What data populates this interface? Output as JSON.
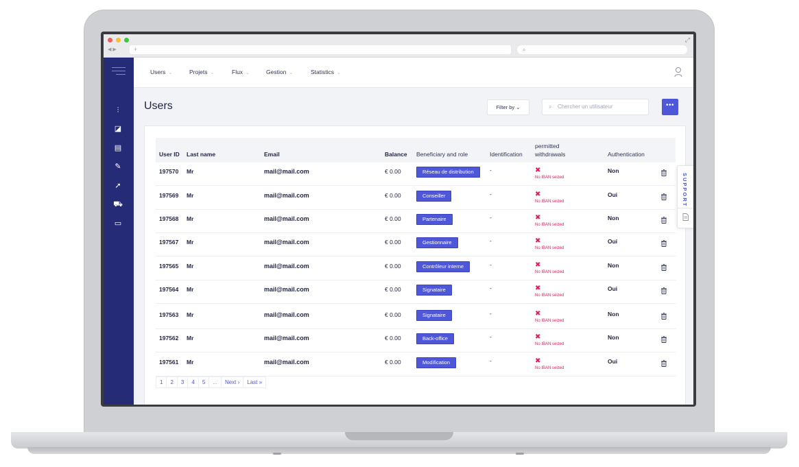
{
  "browser": {
    "url_placeholder": "+",
    "search_placeholder": "⌕",
    "nav_buttons": "◀ ▶",
    "expand_icon": "⤢"
  },
  "topnav": {
    "items": [
      {
        "label": "Users"
      },
      {
        "label": "Projets"
      },
      {
        "label": "Flux"
      },
      {
        "label": "Gestion"
      },
      {
        "label": "Statistics"
      }
    ],
    "chevron": "⌄"
  },
  "page": {
    "title": "Users",
    "filter_label": "Filter by ⌄",
    "search_placeholder": "Chercher un utilisateur",
    "more_label": "•••"
  },
  "table": {
    "headers": {
      "user_id": "User ID",
      "last_name": "Last name",
      "email": "Email",
      "balance": "Balance",
      "role": "Beneficiary and role",
      "identification": "Identification",
      "withdrawals_1": "permitted",
      "withdrawals_2": "withdrawals",
      "authentication": "Authentication"
    },
    "rows": [
      {
        "id": "197570",
        "name": "Mr",
        "email": "mail@mail.com",
        "balance": "€ 0.00",
        "role": "Réseau de distribution",
        "ident": "-",
        "withdraw_mark": "✖",
        "withdraw": "No IBAN seized",
        "auth": "Non"
      },
      {
        "id": "197569",
        "name": "Mr",
        "email": "mail@mail.com",
        "balance": "€ 0.00",
        "role": "Conseiller",
        "ident": "-",
        "withdraw_mark": "✖",
        "withdraw": "No IBAN seized",
        "auth": "Oui"
      },
      {
        "id": "197568",
        "name": "Mr",
        "email": "mail@mail.com",
        "balance": "€ 0.00",
        "role": "Partenaire",
        "ident": "-",
        "withdraw_mark": "✖",
        "withdraw": "No IBAN seized",
        "auth": "Non"
      },
      {
        "id": "197567",
        "name": "Mr",
        "email": "mail@mail.com",
        "balance": "€ 0.00",
        "role": "Gestionnaire",
        "ident": "-",
        "withdraw_mark": "✖",
        "withdraw": "No IBAN seized",
        "auth": "Oui"
      },
      {
        "id": "197565",
        "name": "Mr",
        "email": "mail@mail.com",
        "balance": "€ 0.00",
        "role": "Contrôleur interne",
        "ident": "-",
        "withdraw_mark": "✖",
        "withdraw": "No IBAN seized",
        "auth": "Non"
      },
      {
        "id": "197564",
        "name": "Mr",
        "email": "mail@mail.com",
        "balance": "€ 0.00",
        "role": "Signataire",
        "ident": "-",
        "withdraw_mark": "✖",
        "withdraw": "No IBAN seized",
        "auth": "Oui"
      },
      {
        "id": "197563",
        "name": "Mr",
        "email": "mail@mail.com",
        "balance": "€ 0.00",
        "role": "Signataire",
        "ident": "-",
        "withdraw_mark": "✖",
        "withdraw": "No IBAN seized",
        "auth": "Non"
      },
      {
        "id": "197562",
        "name": "Mr",
        "email": "mail@mail.com",
        "balance": "€ 0.00",
        "role": "Back-office",
        "ident": "-",
        "withdraw_mark": "✖",
        "withdraw": "No IBAN seized",
        "auth": "Non"
      },
      {
        "id": "197561",
        "name": "Mr",
        "email": "mail@mail.com",
        "balance": "€ 0.00",
        "role": "Modification",
        "ident": "-",
        "withdraw_mark": "✖",
        "withdraw": "No IBAN seized",
        "auth": "Oui"
      }
    ]
  },
  "pagination": [
    "1",
    "2",
    "3",
    "4",
    "5",
    "...",
    "Next ›",
    "Last »"
  ],
  "support": {
    "label": "SUPPORT"
  },
  "sidebar": {
    "icons": [
      "sliders-icon",
      "chart-icon",
      "clipboard-icon",
      "edit-icon",
      "pointer-icon",
      "cart-icon",
      "document-icon"
    ],
    "glyphs": [
      "⫶",
      "◪",
      "▤",
      "✎",
      "➚",
      "⛟",
      "▭"
    ]
  },
  "colors": {
    "accent": "#4f57d9",
    "sidebar": "#262b78",
    "danger": "#e6195b"
  }
}
